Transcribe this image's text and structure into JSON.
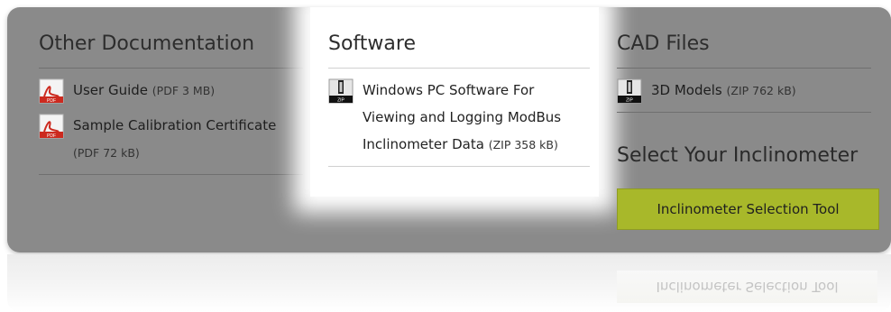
{
  "documentation": {
    "title": "Other Documentation",
    "items": [
      {
        "label": "User Guide",
        "size": "(PDF 3 MB)"
      },
      {
        "label": "Sample Calibration Certificate",
        "size": "(PDF 72 kB)"
      }
    ]
  },
  "software": {
    "title": "Software",
    "items": [
      {
        "line1": "Windows PC Software For",
        "line2": "Viewing and Logging ModBus",
        "line3": "Inclinometer Data",
        "size": "(ZIP 358 kB)"
      }
    ]
  },
  "cad": {
    "title": "CAD Files",
    "items": [
      {
        "label": "3D Models",
        "size": "(ZIP 762 kB)"
      }
    ]
  },
  "selector": {
    "title": "Select Your Inclinometer",
    "button_label": "Inclinometer Selection Tool"
  },
  "icons": {
    "pdf": "pdf-icon",
    "zip": "zip-icon"
  },
  "colors": {
    "panel": "#8a8a8a",
    "button": "#a8b82a",
    "pdf_red": "#cc2a1f"
  }
}
